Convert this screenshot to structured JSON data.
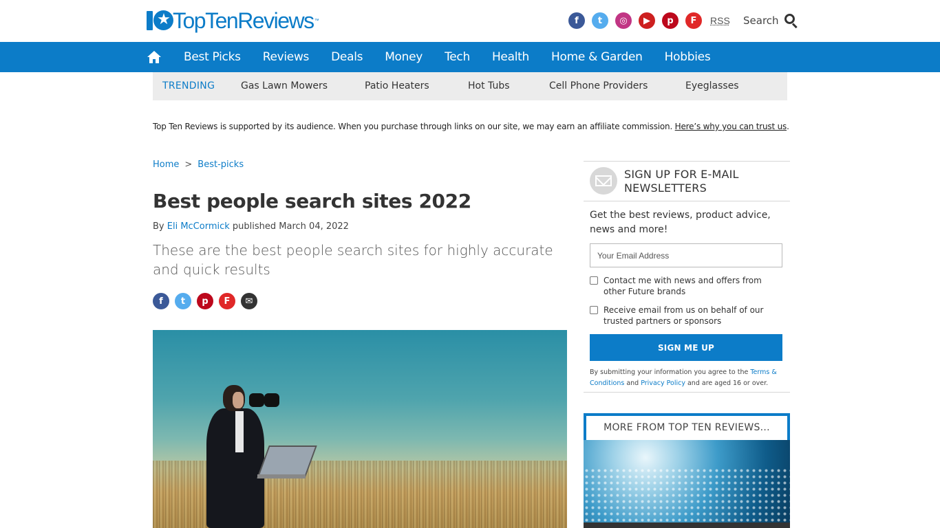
{
  "header": {
    "logo_number": "10",
    "logo_text": "TopTenReviews",
    "logo_tm": "™",
    "rss_label": "RSS",
    "search_label": "Search",
    "social": [
      "facebook-icon",
      "twitter-icon",
      "instagram-icon",
      "youtube-icon",
      "pinterest-icon",
      "flipboard-icon"
    ]
  },
  "nav": {
    "items": [
      "Best Picks",
      "Reviews",
      "Deals",
      "Money",
      "Tech",
      "Health",
      "Home & Garden",
      "Hobbies"
    ]
  },
  "trending": {
    "label": "TRENDING",
    "links": [
      "Gas Lawn Mowers",
      "Patio Heaters",
      "Hot Tubs",
      "Cell Phone Providers",
      "Eyeglasses"
    ]
  },
  "affiliate": {
    "text": "Top Ten Reviews is supported by its audience. When you purchase through links on our site, we may earn an affiliate commission. ",
    "link": "Here’s why you can trust us",
    "end": "."
  },
  "article": {
    "breadcrumb": [
      "Home",
      "Best-picks"
    ],
    "breadcrumb_sep": ">",
    "title": "Best people search sites 2022",
    "by": "By ",
    "author": "Eli McCormick",
    "published": " published March 04, 2022",
    "strap": "These are the best people search sites for highly accurate and quick results"
  },
  "newsletter": {
    "title": "SIGN UP FOR E-MAIL NEWSLETTERS",
    "description": "Get the best reviews, product advice, news and more!",
    "email_placeholder": "Your Email Address",
    "check1": "Contact me with news and offers from other Future brands",
    "check2": "Receive email from us on behalf of our trusted partners or sponsors",
    "button": "SIGN ME UP",
    "terms_pre": "By submitting your information you agree to the ",
    "terms_link": "Terms & Conditions",
    "terms_mid": " and ",
    "privacy_link": "Privacy Policy",
    "terms_post": " and are aged 16 or over."
  },
  "more": {
    "title": "MORE FROM TOP TEN REVIEWS..."
  },
  "colors": {
    "brand": "#0c7cc8",
    "trending_bg": "#ececec"
  }
}
